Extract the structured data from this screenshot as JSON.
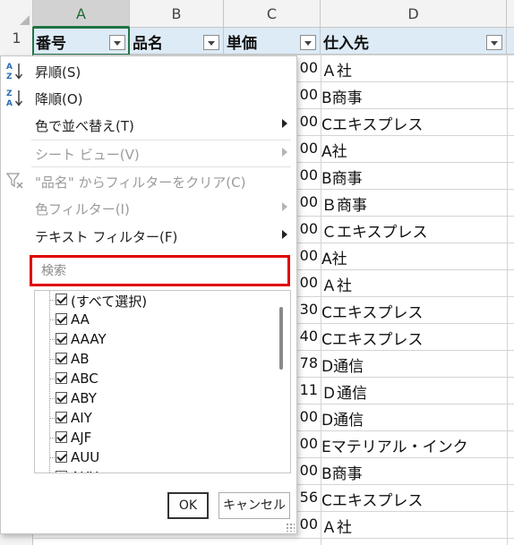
{
  "columns": [
    "A",
    "B",
    "C",
    "D"
  ],
  "row_numbers": [
    "1"
  ],
  "headers": {
    "a": "番号",
    "b": "品名",
    "c": "単価",
    "d": "仕入先"
  },
  "price_cells": [
    "00",
    "00",
    "00",
    "00",
    "00",
    "00",
    "00",
    "00",
    "00",
    "30",
    "40",
    "78",
    "11",
    "00",
    "00",
    "00",
    "56",
    "00"
  ],
  "supplier_cells": [
    "Ａ社",
    "B商事",
    "Cエキスプレス",
    "A社",
    "B商事",
    "Ｂ商事",
    "Ｃエキスプレス",
    "A社",
    "Ａ社",
    "Cエキスプレス",
    "Cエキスプレス",
    "D通信",
    "Ｄ通信",
    "D通信",
    "Eマテリアル・インク",
    "B商事",
    "Cエキスプレス",
    "Ａ社"
  ],
  "filter_menu": {
    "sort_asc": "昇順(S)",
    "sort_desc": "降順(O)",
    "sort_by_color": "色で並べ替え(T)",
    "sheet_view": "シート ビュー(V)",
    "clear_filter": "\"品名\" からフィルターをクリア(C)",
    "color_filter": "色フィルター(I)",
    "text_filter": "テキスト フィルター(F)",
    "search_placeholder": "検索",
    "items": [
      "(すべて選択)",
      "AA",
      "AAAY",
      "AB",
      "ABC",
      "ABY",
      "AIY",
      "AJF",
      "AUU",
      "AUY"
    ],
    "ok_label": "OK",
    "cancel_label": "キャンセル"
  }
}
